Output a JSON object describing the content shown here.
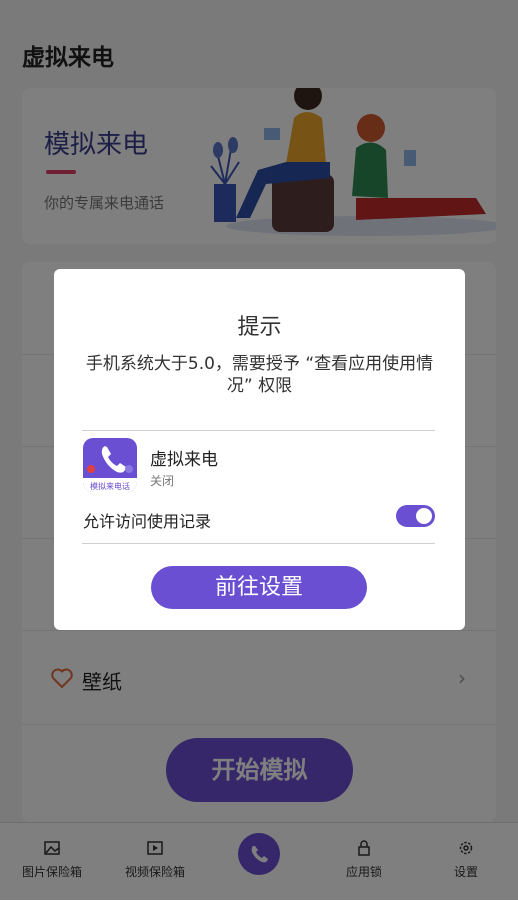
{
  "page": {
    "title": "虚拟来电"
  },
  "banner": {
    "title": "模拟来电",
    "subtitle": "你的专属来电通话"
  },
  "menu": {
    "wallpaper_label": "壁纸",
    "chevron": "›"
  },
  "start_button": "开始模拟",
  "tabs": [
    {
      "label": "图片保险箱",
      "icon": "image-icon"
    },
    {
      "label": "视频保险箱",
      "icon": "video-icon"
    },
    {
      "label": "",
      "icon": "phone-icon"
    },
    {
      "label": "应用锁",
      "icon": "lock-icon"
    },
    {
      "label": "设置",
      "icon": "gear-icon"
    }
  ],
  "dialog": {
    "title": "提示",
    "message": "手机系统大于5.0，需要授予 “查看应用使用情况” 权限",
    "app_name": "虚拟来电",
    "app_state": "关闭",
    "app_icon_caption": "模拟来电话",
    "permission_label": "允许访问使用记录",
    "permission_on": true,
    "button": "前往设置"
  },
  "colors": {
    "accent": "#6a4fd3",
    "banner_title": "#3a3f8f",
    "banner_line": "#e0406a"
  }
}
